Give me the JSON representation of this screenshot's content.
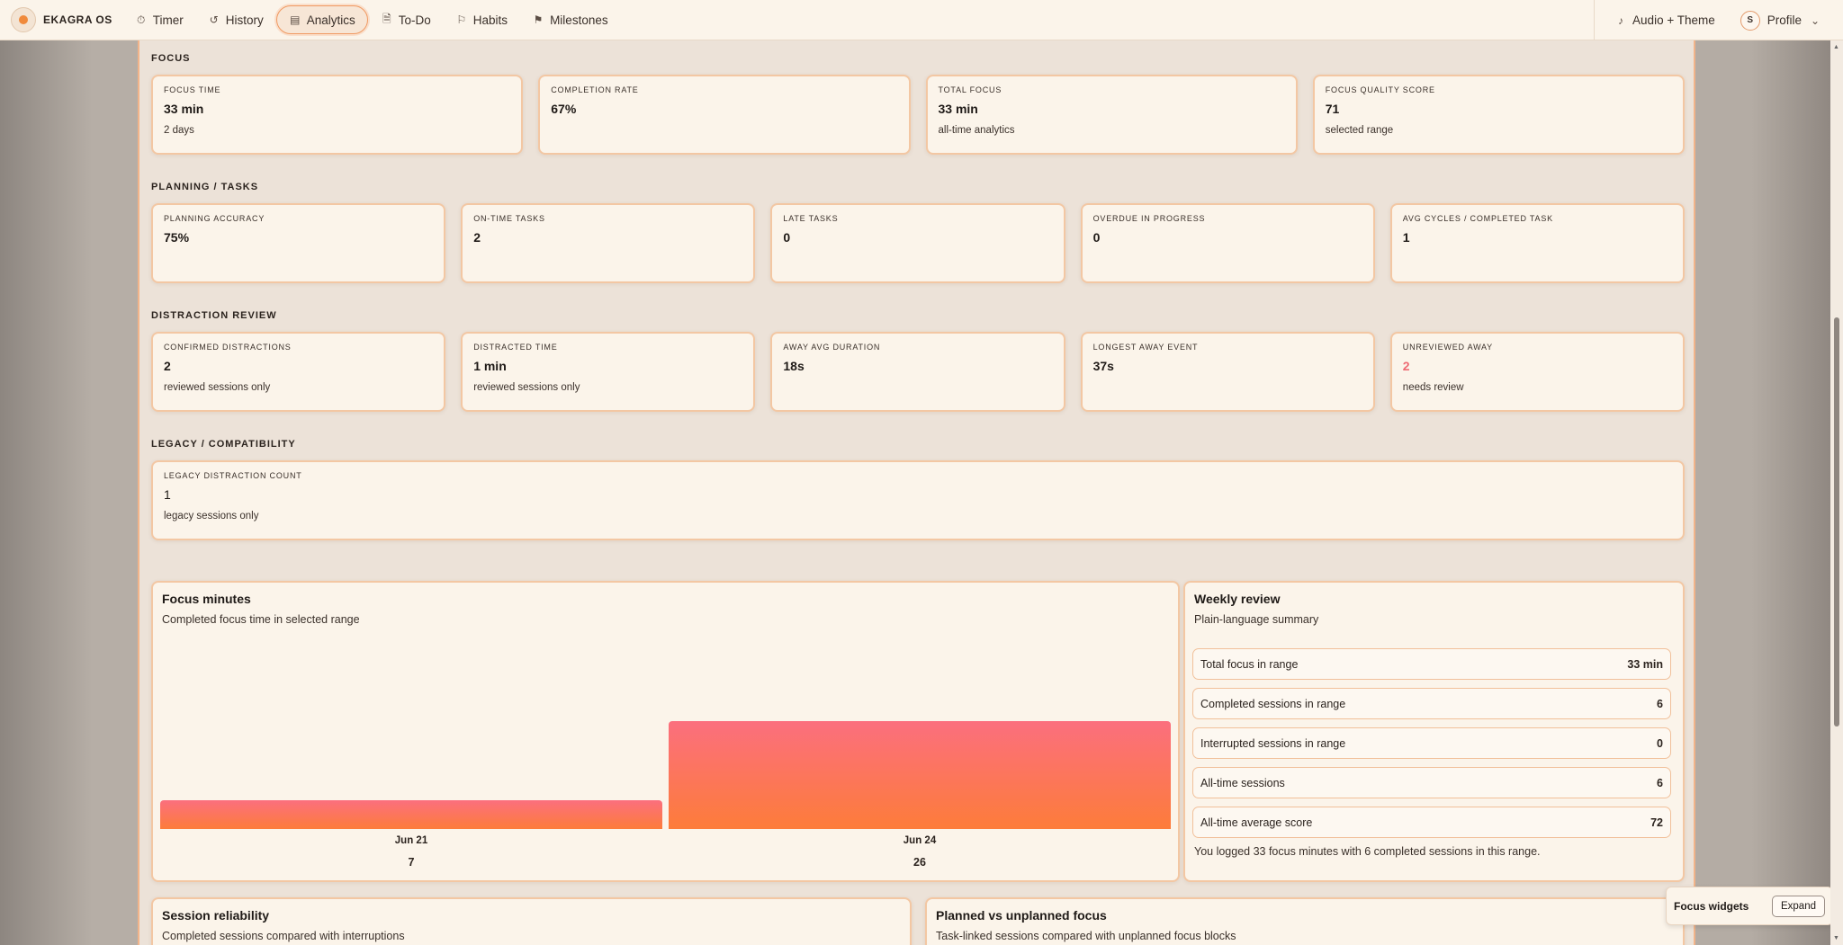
{
  "app": {
    "brand": "EKAGRA OS"
  },
  "nav": {
    "items": [
      {
        "label": "Timer",
        "icon": "timer-icon",
        "glyph": "⏱"
      },
      {
        "label": "History",
        "icon": "history-icon",
        "glyph": "↺"
      },
      {
        "label": "Analytics",
        "icon": "analytics-icon",
        "glyph": "▤"
      },
      {
        "label": "To-Do",
        "icon": "todo-icon",
        "glyph": "🗎"
      },
      {
        "label": "Habits",
        "icon": "habits-icon",
        "glyph": "⚐"
      },
      {
        "label": "Milestones",
        "icon": "milestones-icon",
        "glyph": "⚑"
      }
    ],
    "active": "Analytics",
    "audio_label": "Audio + Theme",
    "profile_label": "Profile",
    "profile_initial": "S"
  },
  "sections": {
    "focus": {
      "title": "FOCUS",
      "cards": [
        {
          "label": "FOCUS TIME",
          "value": "33 min",
          "sub": "2 days"
        },
        {
          "label": "COMPLETION RATE",
          "value": "67%",
          "sub": ""
        },
        {
          "label": "TOTAL FOCUS",
          "value": "33 min",
          "sub": "all-time analytics"
        },
        {
          "label": "FOCUS QUALITY SCORE",
          "value": "71",
          "sub": "selected range"
        }
      ]
    },
    "planning": {
      "title": "PLANNING / TASKS",
      "cards": [
        {
          "label": "PLANNING ACCURACY",
          "value": "75%",
          "sub": ""
        },
        {
          "label": "ON-TIME TASKS",
          "value": "2",
          "sub": ""
        },
        {
          "label": "LATE TASKS",
          "value": "0",
          "sub": ""
        },
        {
          "label": "OVERDUE IN PROGRESS",
          "value": "0",
          "sub": ""
        },
        {
          "label": "AVG CYCLES / COMPLETED TASK",
          "value": "1",
          "sub": ""
        }
      ]
    },
    "distraction": {
      "title": "DISTRACTION REVIEW",
      "cards": [
        {
          "label": "CONFIRMED DISTRACTIONS",
          "value": "2",
          "sub": "reviewed sessions only"
        },
        {
          "label": "DISTRACTED TIME",
          "value": "1 min",
          "sub": "reviewed sessions only"
        },
        {
          "label": "AWAY AVG DURATION",
          "value": "18s",
          "sub": ""
        },
        {
          "label": "LONGEST AWAY EVENT",
          "value": "37s",
          "sub": ""
        },
        {
          "label": "UNREVIEWED AWAY",
          "value": "2",
          "sub": "needs review"
        }
      ]
    },
    "legacy": {
      "title": "LEGACY / COMPATIBILITY",
      "card": {
        "label": "LEGACY DISTRACTION COUNT",
        "value": "1",
        "sub": "legacy sessions only"
      }
    }
  },
  "focus_chart": {
    "title": "Focus minutes",
    "subtitle": "Completed focus time in selected range"
  },
  "chart_data": {
    "type": "bar",
    "title": "Focus minutes",
    "subtitle": "Completed focus time in selected range",
    "categories": [
      "Jun 21",
      "Jun 24"
    ],
    "values": [
      7,
      26
    ],
    "ylim": [
      0,
      33
    ],
    "grid": false,
    "colors": {
      "top": "#fb6f7e",
      "bottom": "#fd7c3a"
    }
  },
  "weekly_review": {
    "title": "Weekly review",
    "subtitle": "Plain-language summary",
    "rows": [
      {
        "label": "Total focus in range",
        "value": "33 min"
      },
      {
        "label": "Completed sessions in range",
        "value": "6"
      },
      {
        "label": "Interrupted sessions in range",
        "value": "0"
      },
      {
        "label": "All-time sessions",
        "value": "6"
      },
      {
        "label": "All-time average score",
        "value": "72"
      }
    ],
    "note": "You logged 33 focus minutes with 6 completed sessions in this range."
  },
  "session_reliability": {
    "title": "Session reliability",
    "subtitle": "Completed sessions compared with interruptions"
  },
  "planned_vs_unplanned": {
    "title": "Planned vs unplanned focus",
    "subtitle": "Task-linked sessions compared with unplanned focus blocks"
  },
  "widget": {
    "title": "Focus widgets",
    "button": "Expand"
  },
  "colors": {
    "accent": "#f09a62",
    "alert": "#ee6a73",
    "panel": "#fbf4ea"
  }
}
